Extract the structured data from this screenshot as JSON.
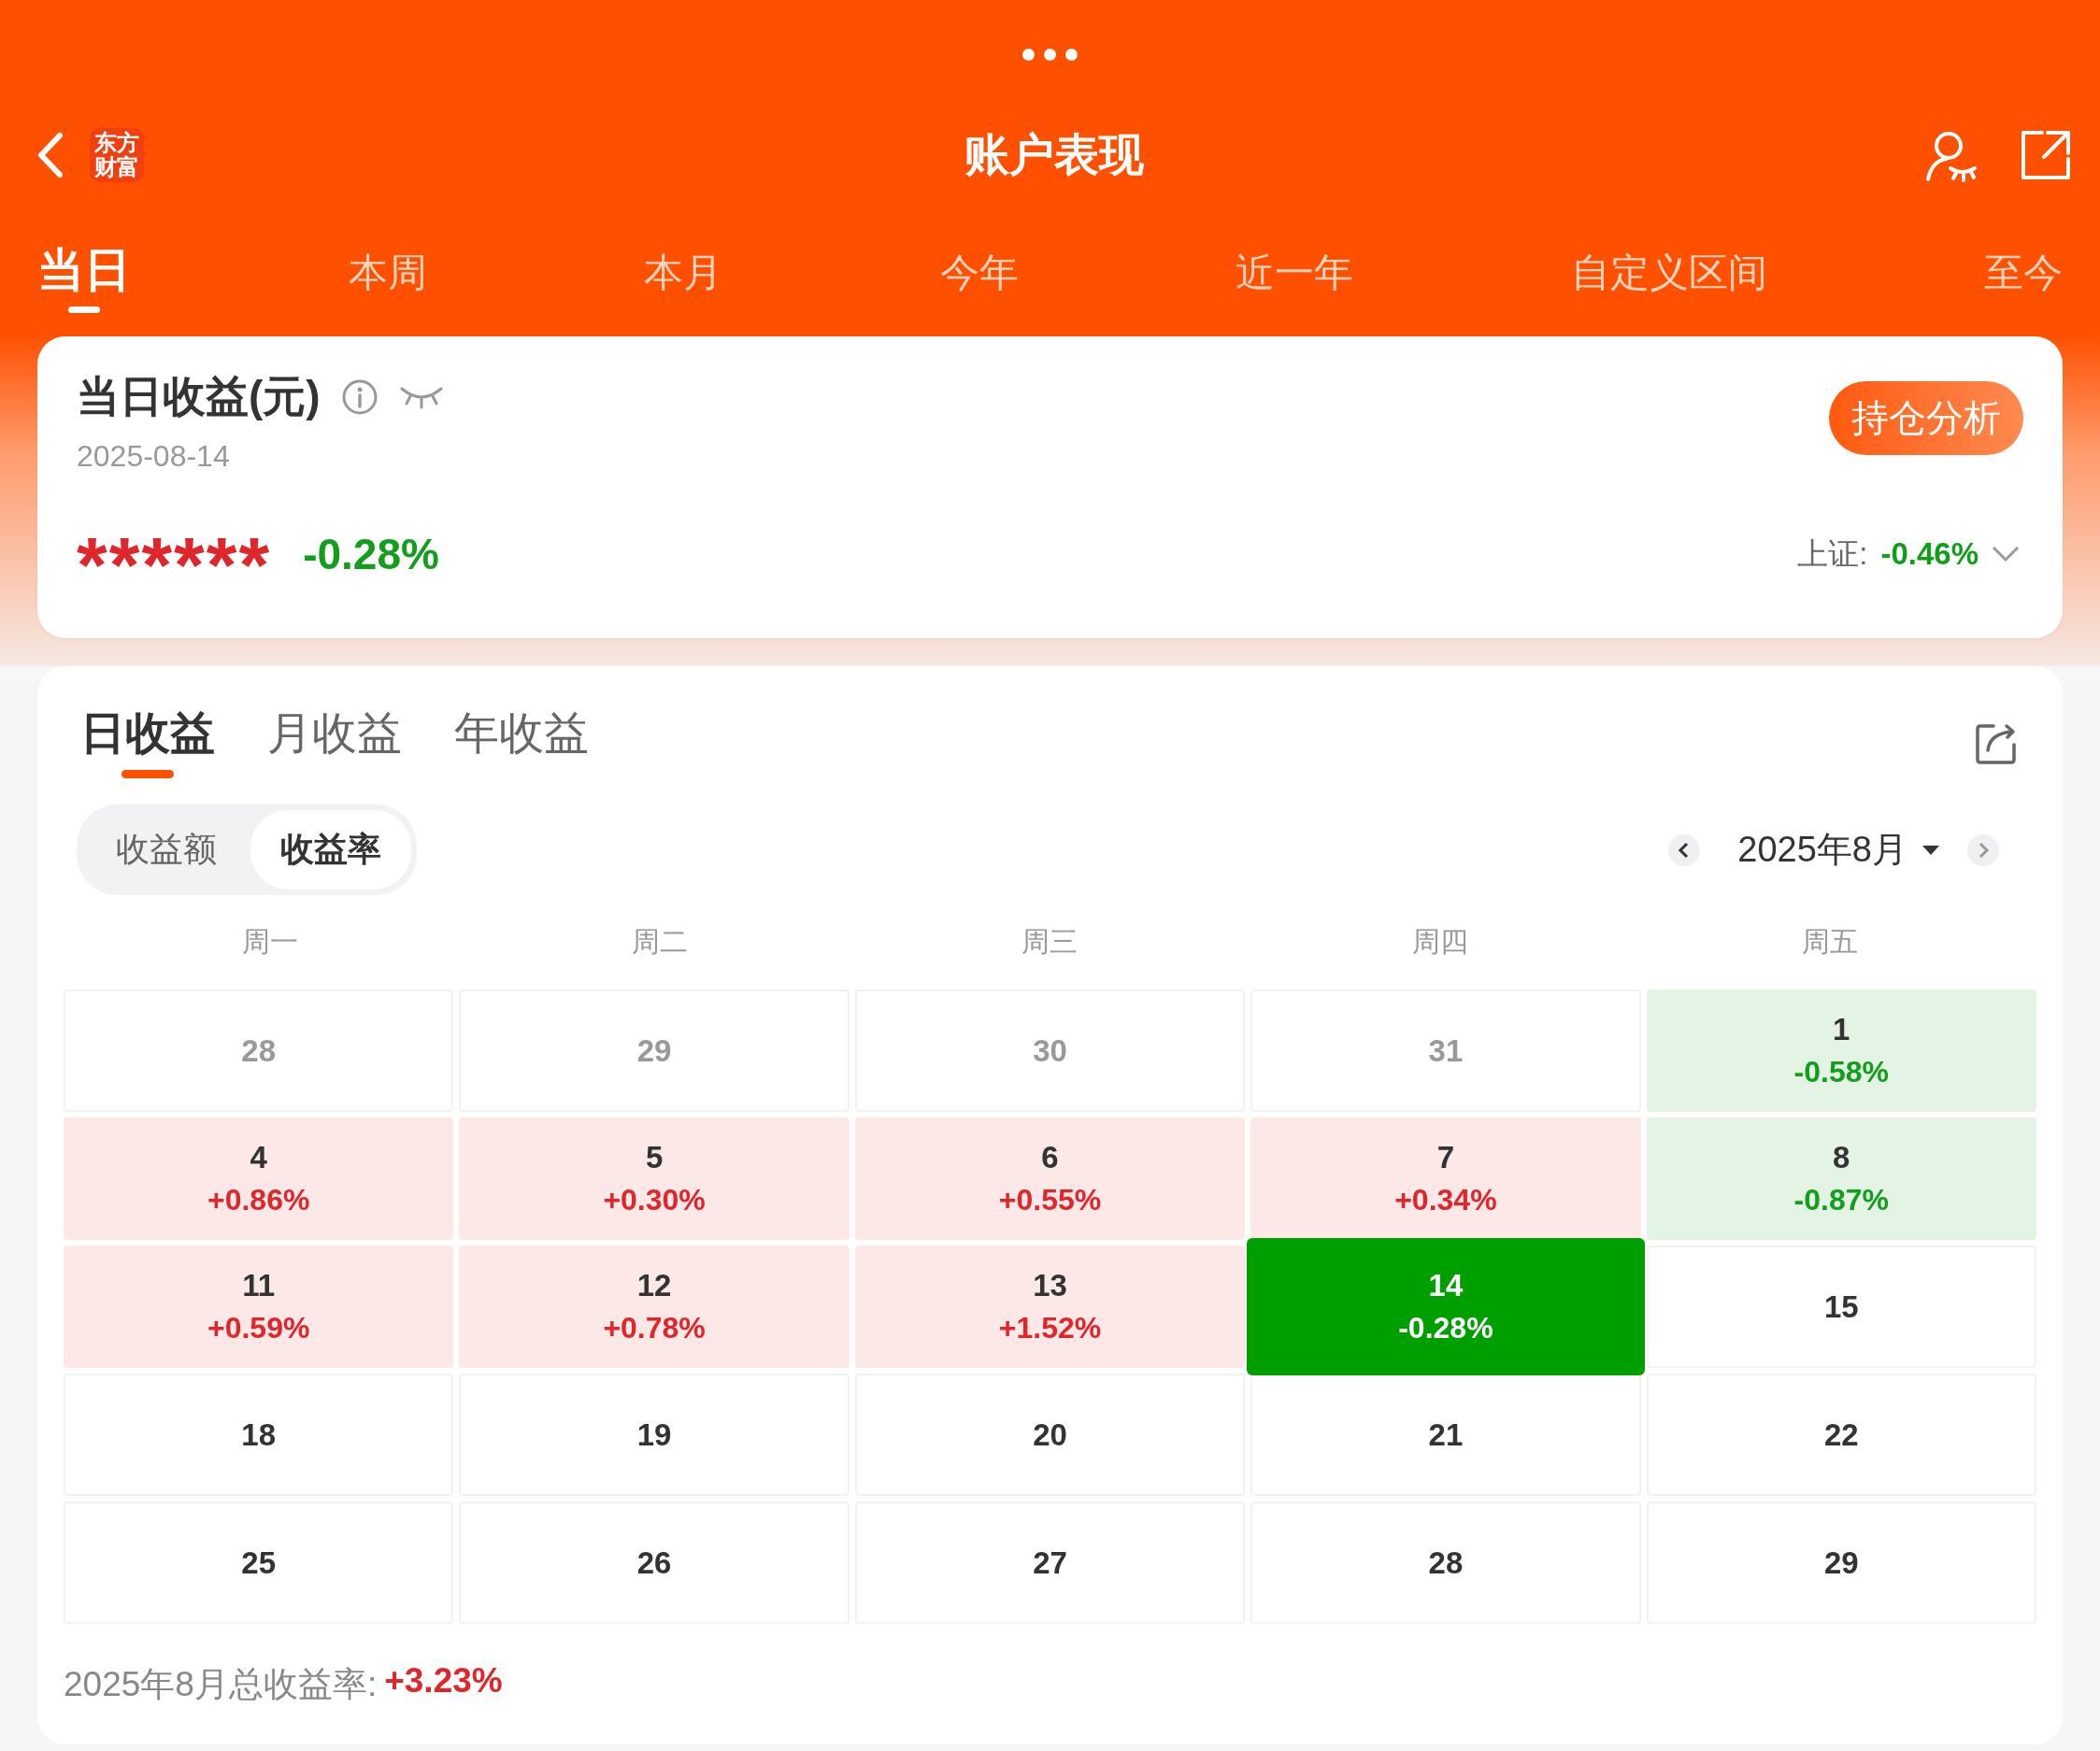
{
  "header": {
    "title": "账户表现",
    "logo_lines": [
      "东方",
      "财富"
    ]
  },
  "period_tabs": [
    {
      "label": "当日",
      "selected": true
    },
    {
      "label": "本周",
      "selected": false
    },
    {
      "label": "本月",
      "selected": false
    },
    {
      "label": "今年",
      "selected": false
    },
    {
      "label": "近一年",
      "selected": false
    },
    {
      "label": "自定义区间",
      "selected": false
    },
    {
      "label": "至今",
      "selected": false
    }
  ],
  "summary": {
    "title": "当日收益(元)",
    "date": "2025-08-14",
    "amount": "******",
    "rate": "-0.28%",
    "button": "持仓分析",
    "index_label": "上证:",
    "index_value": "-0.46%"
  },
  "calendar": {
    "tabs": [
      {
        "label": "日收益",
        "selected": true
      },
      {
        "label": "月收益",
        "selected": false
      },
      {
        "label": "年收益",
        "selected": false
      }
    ],
    "modes": [
      {
        "label": "收益额",
        "selected": false
      },
      {
        "label": "收益率",
        "selected": true
      }
    ],
    "month": "2025年8月",
    "weekdays": [
      "周一",
      "周二",
      "周三",
      "周四",
      "周五"
    ],
    "cells": [
      {
        "day": "28",
        "kind": "outside",
        "selected": false
      },
      {
        "day": "29",
        "kind": "outside",
        "selected": false
      },
      {
        "day": "30",
        "kind": "outside",
        "selected": false
      },
      {
        "day": "31",
        "kind": "outside",
        "selected": false
      },
      {
        "day": "1",
        "change": "-0.58%",
        "kind": "loss",
        "selected": false
      },
      {
        "day": "4",
        "change": "+0.86%",
        "kind": "gain",
        "selected": false
      },
      {
        "day": "5",
        "change": "+0.30%",
        "kind": "gain",
        "selected": false
      },
      {
        "day": "6",
        "change": "+0.55%",
        "kind": "gain",
        "selected": false
      },
      {
        "day": "7",
        "change": "+0.34%",
        "kind": "gain",
        "selected": false
      },
      {
        "day": "8",
        "change": "-0.87%",
        "kind": "loss",
        "selected": false
      },
      {
        "day": "11",
        "change": "+0.59%",
        "kind": "gain",
        "selected": false
      },
      {
        "day": "12",
        "change": "+0.78%",
        "kind": "gain",
        "selected": false
      },
      {
        "day": "13",
        "change": "+1.52%",
        "kind": "gain",
        "selected": false
      },
      {
        "day": "14",
        "change": "-0.28%",
        "kind": "loss",
        "selected": true
      },
      {
        "day": "15",
        "kind": "plain",
        "selected": false
      },
      {
        "day": "18",
        "kind": "plain",
        "selected": false
      },
      {
        "day": "19",
        "kind": "plain",
        "selected": false
      },
      {
        "day": "20",
        "kind": "plain",
        "selected": false
      },
      {
        "day": "21",
        "kind": "plain",
        "selected": false
      },
      {
        "day": "22",
        "kind": "plain",
        "selected": false
      },
      {
        "day": "25",
        "kind": "plain",
        "selected": false
      },
      {
        "day": "26",
        "kind": "plain",
        "selected": false
      },
      {
        "day": "27",
        "kind": "plain",
        "selected": false
      },
      {
        "day": "28",
        "kind": "plain",
        "selected": false
      },
      {
        "day": "29",
        "kind": "plain",
        "selected": false
      }
    ],
    "total_label": "2025年8月总收益率:",
    "total_value": "+3.23%"
  }
}
